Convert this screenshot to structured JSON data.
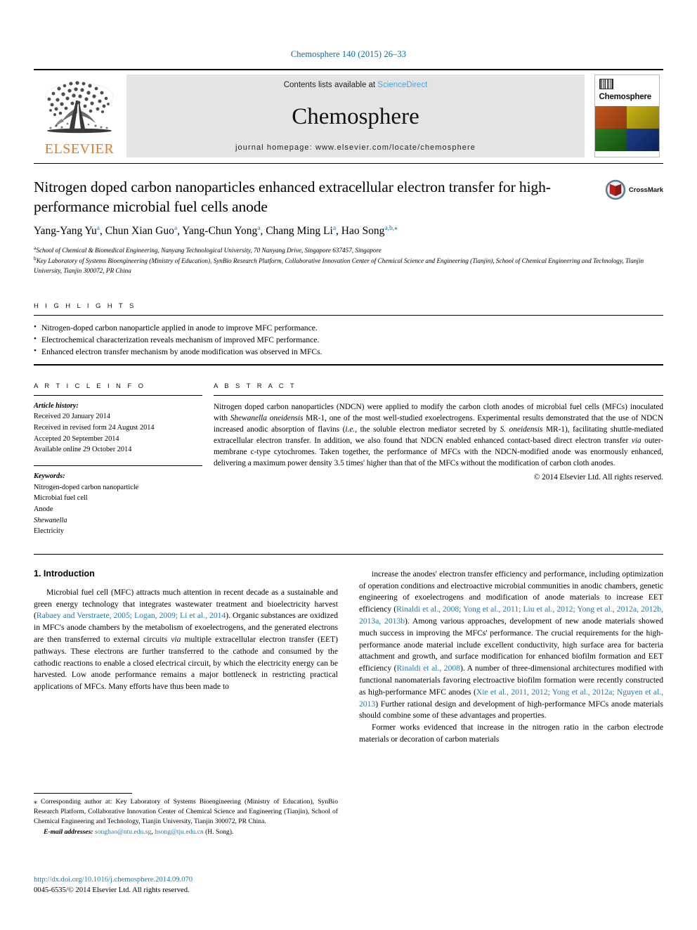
{
  "runhead": "Chemosphere 140 (2015) 26–33",
  "masthead": {
    "publisher": "ELSEVIER",
    "contents_prefix": "Contents lists available at ",
    "contents_link": "ScienceDirect",
    "journal_title": "Chemosphere",
    "homepage": "journal homepage: www.elsevier.com/locate/chemosphere",
    "cover_title": "Chemosphere"
  },
  "article": {
    "title": "Nitrogen doped carbon nanoparticles enhanced extracellular electron transfer for high-performance microbial fuel cells anode",
    "crossmark_label": "CrossMark",
    "authors": [
      {
        "name": "Yang-Yang Yu",
        "sup": "a",
        "sep": ", "
      },
      {
        "name": "Chun Xian Guo",
        "sup": "a",
        "sep": ", "
      },
      {
        "name": "Yang-Chun Yong",
        "sup": "a",
        "sep": ", "
      },
      {
        "name": "Chang Ming Li",
        "sup": "a",
        "sep": ", "
      },
      {
        "name": "Hao Song",
        "sup": "a,b,⁎",
        "sep": ""
      }
    ],
    "affiliations": [
      {
        "sup": "a",
        "text": "School of Chemical & Biomedical Engineering, Nanyang Technological University, 70 Nanyang Drive, Singapore 637457, Singapore"
      },
      {
        "sup": "b",
        "text": "Key Laboratory of Systems Bioengineering (Ministry of Education), SynBio Research Platform, Collaborative Innovation Center of Chemical Science and Engineering (Tianjin), School of Chemical Engineering and Technology, Tianjin University, Tianjin 300072, PR China"
      }
    ]
  },
  "highlights": {
    "label": "H I G H L I G H T S",
    "items": [
      "Nitrogen-doped carbon nanoparticle applied in anode to improve MFC performance.",
      "Electrochemical characterization reveals mechanism of improved MFC performance.",
      "Enhanced electron transfer mechanism by anode modification was observed in MFCs."
    ]
  },
  "article_info": {
    "label": "A R T I C L E    I N F O",
    "history_label": "Article history:",
    "history": [
      "Received 20 January 2014",
      "Received in revised form 24 August 2014",
      "Accepted 20 September 2014",
      "Available online 29 October 2014"
    ],
    "keywords_label": "Keywords:",
    "keywords": [
      "Nitrogen-doped carbon nanoparticle",
      "Microbial fuel cell",
      "Anode",
      "Shewanella",
      "Electricity"
    ],
    "keyword_italic_index": 3
  },
  "abstract": {
    "label": "A B S T R A C T",
    "text_parts": [
      {
        "t": "Nitrogen doped carbon nanoparticles (NDCN) were applied to modify the carbon cloth anodes of microbial fuel cells (MFCs) inoculated with "
      },
      {
        "t": "Shewanella oneidensis",
        "i": true
      },
      {
        "t": " MR-1, one of the most well-studied exoelectrogens. Experimental results demonstrated that the use of NDCN increased anodic absorption of flavins ("
      },
      {
        "t": "i.e.",
        "i": true
      },
      {
        "t": ", the soluble electron mediator secreted by "
      },
      {
        "t": "S. oneidensis",
        "i": true
      },
      {
        "t": " MR-1), facilitating shuttle-mediated extracellular electron transfer. In addition, we also found that NDCN enabled enhanced contact-based direct electron transfer "
      },
      {
        "t": "via",
        "i": true
      },
      {
        "t": " outer-membrane c-type cytochromes. Taken together, the performance of MFCs with the NDCN-modified anode was enormously enhanced, delivering a maximum power density 3.5 times' higher than that of the MFCs without the modification of carbon cloth anodes."
      }
    ],
    "copyright": "© 2014 Elsevier Ltd. All rights reserved."
  },
  "body": {
    "section_heading": "1. Introduction",
    "left_paragraph_parts": [
      {
        "t": "Microbial fuel cell (MFC) attracts much attention in recent decade as a sustainable and green energy technology that integrates wastewater treatment and bioelectricity harvest ("
      },
      {
        "t": "Rabaey and Verstraete, 2005; Logan, 2009; Li et al., 2014",
        "ref": true
      },
      {
        "t": "). Organic substances are oxidized in MFC's anode chambers by the metabolism of exoelectrogens, and the generated electrons are then transferred to external circuits "
      },
      {
        "t": "via",
        "i": true
      },
      {
        "t": " multiple extracellular electron transfer (EET) pathways. These electrons are further transferred to the cathode and consumed by the cathodic reactions to enable a closed electrical circuit, by which the electricity energy can be harvested. Low anode performance remains a major bottleneck in restricting practical applications of MFCs. Many efforts have thus been made to"
      }
    ],
    "right_paragraph1_parts": [
      {
        "t": "increase the anodes' electron transfer efficiency and performance, including optimization of operation conditions and electroactive microbial communities in anodic chambers, genetic engineering of exoelectrogens and modification of anode materials to increase EET efficiency ("
      },
      {
        "t": "Rinaldi et al., 2008; Yong et al., 2011; Liu et al., 2012; Yong et al., 2012a, 2012b, 2013a, 2013b",
        "ref": true
      },
      {
        "t": "). Among various approaches, development of new anode materials showed much success in improving the MFCs' performance. The crucial requirements for the high-performance anode material include excellent conductivity, high surface area for bacteria attachment and growth, and surface modification for enhanced biofilm formation and EET efficiency ("
      },
      {
        "t": "Rinaldi et al., 2008",
        "ref": true
      },
      {
        "t": "). A number of three-dimensional architectures modified with functional nanomaterials favoring electroactive biofilm formation were recently constructed as high-performance MFC anodes ("
      },
      {
        "t": "Xie et al., 2011, 2012; Yong et al., 2012a; Nguyen et al., 2013",
        "ref": true
      },
      {
        "t": ") Further rational design and development of high-performance MFCs anode materials should combine some of these advantages and properties."
      }
    ],
    "right_paragraph2_parts": [
      {
        "t": "Former works evidenced that increase in the nitrogen ratio in the carbon electrode materials or decoration of carbon materials"
      }
    ]
  },
  "footnotes": {
    "corresponding_parts": [
      {
        "t": "⁎ Corresponding author at: Key Laboratory of Systems Bioengineering (Ministry of Education), SynBio Research Platform, Collaborative Innovation Center of Chemical Science and Engineering (Tianjin), School of Chemical Engineering and Technology, Tianjin University, Tianjin 300072, PR China."
      }
    ],
    "email_label": "E-mail addresses:",
    "emails": [
      {
        "addr": "songhao@ntu.edu.sg",
        "sep": ", "
      },
      {
        "addr": "hsong@tju.edu.cn",
        "sep": ""
      }
    ],
    "email_suffix": " (H. Song).",
    "doi": "http://dx.doi.org/10.1016/j.chemosphere.2014.09.070",
    "issn": "0045-6535/© 2014 Elsevier Ltd. All rights reserved."
  },
  "colors": {
    "link_blue": "#1c7ab0",
    "runhead_blue": "#0b6aa2",
    "elsevier_orange": "#E87722",
    "banner_grey": "#e4e4e4"
  }
}
